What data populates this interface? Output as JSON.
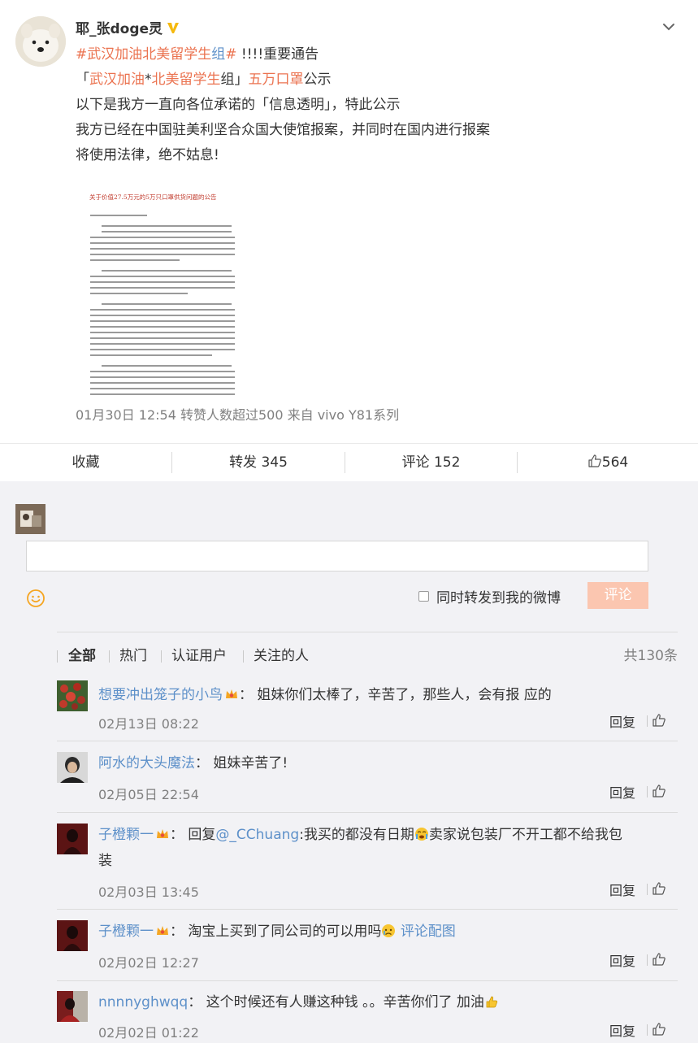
{
  "post": {
    "author": "耶_张doge灵",
    "hashtag_open": "#",
    "hashtag_text": "武汉加油北美留学生",
    "hashtag_tail": "组",
    "hashtag_close": "#",
    "line1_rest": " !!!!重要通告",
    "line2_bracket_open": "「",
    "line2_hl1": "武汉加油",
    "line2_star": "*",
    "line2_hl2": "北美留学生",
    "line2_mid": "组」",
    "line2_hl3": "五万口罩",
    "line2_end": "公示",
    "line3": "以下是我方一直向各位承诺的「信息透明」，特此公示",
    "line4": "我方已经在中国驻美利坚合众国大使馆报案，并同时在国内进行报案",
    "line5": "将使用法律，绝不姑息!",
    "image": {
      "title": "关于价值27.5万元的5万只口罩供货问题的公告"
    },
    "meta": "01月30日 12:54  转赞人数超过500   来自 vivo Y81系列"
  },
  "actions": {
    "favorite": "收藏",
    "repost": "转发 345",
    "comment": "评论 152",
    "like": "564"
  },
  "composer": {
    "input_value": "",
    "forward_label": "同时转发到我的微博",
    "submit_label": "评论"
  },
  "filters": {
    "items": [
      "全部",
      "热门",
      "认证用户",
      "关注的人"
    ],
    "active": "全部",
    "total": "共130条"
  },
  "comments": [
    {
      "user": "想要冲出笼子的小鸟",
      "text": "姐妹你们太棒了，辛苦了，那些人，会有报 应的",
      "time": "02月13日 08:22",
      "reply": "回复"
    },
    {
      "user": "阿水的大头魔法",
      "text": "姐妹辛苦了!",
      "time": "02月05日 22:54",
      "reply": "回复"
    },
    {
      "user": "子橙颗一",
      "reply_prefix": "回复",
      "mention": "@_CChuang",
      "text_a": ":我买的都没有日期",
      "text_b": "卖家说包装厂不开工都不给我包",
      "text_c": "装",
      "time": "02月03日 13:45",
      "reply": "回复"
    },
    {
      "user": "子橙颗一",
      "text": "淘宝上买到了同公司的可以用吗",
      "link": "评论配图",
      "time": "02月02日 12:27",
      "reply": "回复"
    },
    {
      "user": "nnnnyghwqq",
      "text": "这个时候还有人赚这种钱 。。辛苦你们了 加油",
      "time": "02月02日 01:22",
      "reply": "回复"
    }
  ],
  "icons": {
    "verified": "v-badge-icon",
    "chevron": "chevron-down-icon",
    "like": "thumbs-up-icon",
    "smile": "smile-icon",
    "member": "crown-icon"
  },
  "colors": {
    "accent_orange": "#eb7350",
    "link_blue": "#5d90c9",
    "submit_disabled": "#fbc6b0",
    "comment_bg": "#f2f2f5"
  }
}
